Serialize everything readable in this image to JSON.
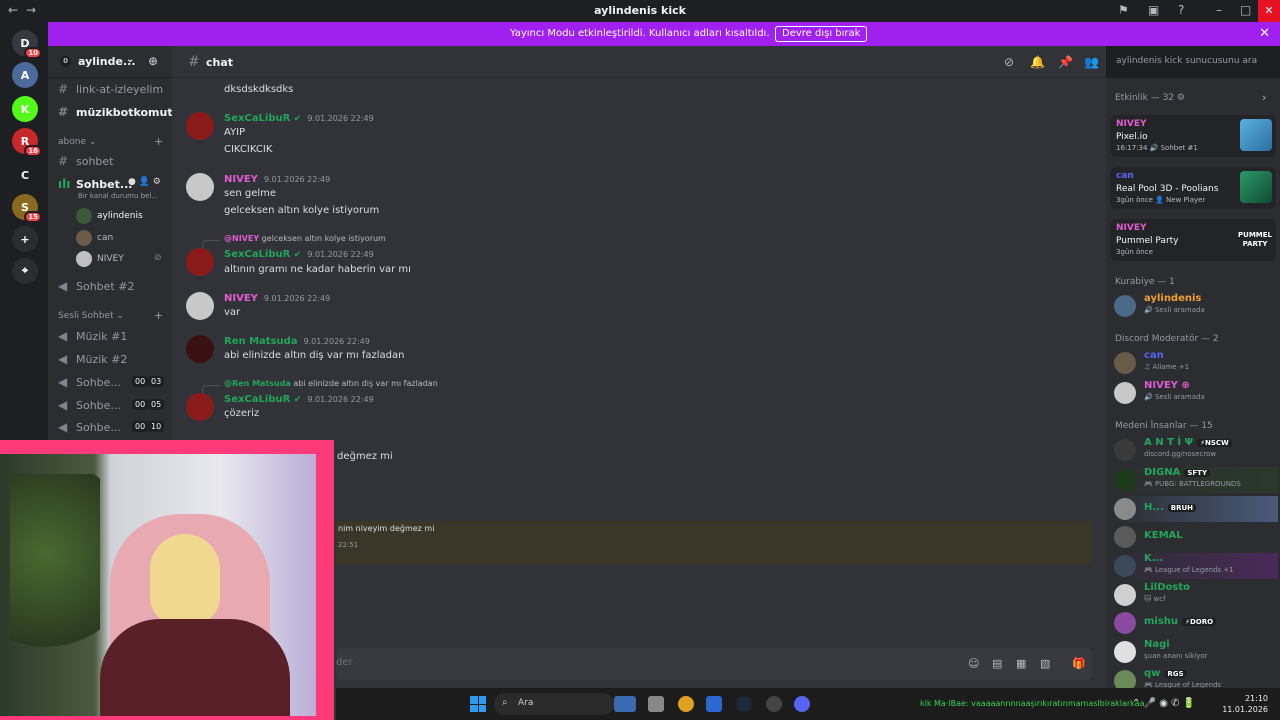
{
  "window": {
    "title": "aylindenis kick"
  },
  "banner": {
    "text": "Yayıncı Modu etkinleştirildi. Kullanıcı adları kısaltıldı.",
    "button": "Devre dışı bırak"
  },
  "servers": [
    {
      "name": "D",
      "badge": "10",
      "color": "#36393f"
    },
    {
      "name": "A",
      "badge": "",
      "color": "#4c6a9c"
    },
    {
      "name": "K",
      "badge": "",
      "color": "#53fc18"
    },
    {
      "name": "R",
      "badge": "16",
      "color": "#c9282b"
    },
    {
      "name": "C",
      "badge": "",
      "color": "#1e1f22"
    },
    {
      "name": "S",
      "badge": "15",
      "color": "#8a6a20"
    },
    {
      "name": "+",
      "badge": "",
      "color": "#2b2d31"
    },
    {
      "name": "⌖",
      "badge": "",
      "color": "#2b2d31"
    }
  ],
  "sidebar": {
    "zero": "0",
    "server_name": "aylinde...",
    "channels_top": [
      {
        "prefix": "#",
        "label": "link-at-izleyelim"
      },
      {
        "prefix": "#",
        "label": "müzikbotkomut"
      }
    ],
    "cat_abone": "abone ⌄",
    "sohbet_text": "sohbet",
    "voice_active": "Sohbet...",
    "voice_status": "Bir kanal durumu bel...",
    "voice_users": [
      "aylindenis",
      "can",
      "NIVEY"
    ],
    "sohbet2": "Sohbet #2",
    "cat_sesli": "Sesli Sohbet ⌄",
    "voice_channels": [
      {
        "label": "Müzik #1",
        "a": "",
        "b": ""
      },
      {
        "label": "Müzik #2",
        "a": "",
        "b": ""
      },
      {
        "label": "Sohbe...",
        "a": "00",
        "b": "03"
      },
      {
        "label": "Sohbe...",
        "a": "00",
        "b": "05"
      },
      {
        "label": "Sohbe...",
        "a": "00",
        "b": "10"
      }
    ]
  },
  "chat": {
    "channel": "chat",
    "search_placeholder": "aylindenis kick sunucusunu ara",
    "composer_placeholder": "der",
    "messages": [
      {
        "line1": "dksdskdksdks"
      },
      {
        "author": "SexCaLibuR",
        "time": "9.01.2026 22:49",
        "line1": "AYIP",
        "line2": "CIKCIKCIK"
      },
      {
        "author": "NIVEY",
        "time": "9.01.2026 22:49",
        "line1": "sen gelme",
        "line2": "gelceksen altın kolye istiyorum"
      },
      {
        "reply_who": "@NIVEY",
        "reply_text": "gelceksen altın kolye istiyorum",
        "author": "SexCaLibuR",
        "time": "9.01.2026 22:49",
        "line1": "altının gramı ne kadar haberin var mı"
      },
      {
        "author": "NIVEY",
        "time": "9.01.2026 22:49",
        "line1": "var"
      },
      {
        "author": "Ren Matsuda",
        "time": "9.01.2026 22:49",
        "line1": "abi elinizde altın diş var mı fazladan"
      },
      {
        "reply_who": "@Ren Matsuda",
        "reply_text": "abi elinizde altın diş var mı fazladan",
        "author": "SexCaLibuR",
        "time": "9.01.2026 22:49",
        "line1": "çözeriz"
      },
      {
        "line1": "değmez mi"
      },
      {
        "line1": "nim niveyim değmez mi",
        "time": "22:51"
      }
    ]
  },
  "members": {
    "activity_title": "Etkinlik — 32 ⚙",
    "activities": [
      {
        "user": "NIVEY",
        "game": "Pixel.io",
        "meta": "16:17:34  🔊 Sohbet #1",
        "color": "#e15bd0"
      },
      {
        "user": "can",
        "game": "Real Pool 3D - Poolians",
        "meta": "3gün önce  👤 New Player",
        "color": "#5865f2"
      },
      {
        "user": "NIVEY",
        "game": "Pummel Party",
        "meta": "3gün önce",
        "color": "#e15bd0"
      }
    ],
    "pummel_logo": "PUMMEL PARTY",
    "sections": [
      {
        "title": "Kurabiye — 1",
        "members": [
          {
            "name": "aylindenis",
            "status": "🔊 Sesli aramada",
            "color": "#f0a030",
            "tag": ""
          }
        ]
      },
      {
        "title": "Discord Moderatör — 2",
        "members": [
          {
            "name": "can",
            "status": "♫ Allame +1",
            "color": "#5865f2",
            "tag": ""
          },
          {
            "name": "NIVEY ⊕",
            "status": "🔊 Sesli aramada",
            "color": "#e15bd0",
            "tag": ""
          }
        ]
      },
      {
        "title": "Medeni İnsanlar — 15",
        "members": [
          {
            "name": "A N T İ Ψ",
            "status": "discord.gg/nosecrow",
            "color": "#23a55a",
            "tag": "⚡NSCW"
          },
          {
            "name": "DIGNA",
            "status": "🎮 PUBG: BATTLEGROUNDS",
            "color": "#23a55a",
            "tag": "SFTY"
          },
          {
            "name": "H...",
            "status": "",
            "color": "#23a55a",
            "tag": "BRUH"
          },
          {
            "name": "KEMAL",
            "status": "",
            "color": "#23a55a",
            "tag": ""
          },
          {
            "name": "K...",
            "status": "🎮 League of Legends +1",
            "color": "#23a55a",
            "tag": ""
          },
          {
            "name": "LilDosto",
            "status": "🐱 wcf",
            "color": "#23a55a",
            "tag": ""
          },
          {
            "name": "mishu",
            "status": "",
            "color": "#23a55a",
            "tag": "⚡DORO"
          },
          {
            "name": "Nagi",
            "status": "şuan ananı sikiyor",
            "color": "#23a55a",
            "tag": ""
          },
          {
            "name": "qw",
            "status": "🎮 League of Legends",
            "color": "#23a55a",
            "tag": "RGS"
          }
        ]
      }
    ]
  },
  "taskbar": {
    "search": "Ara",
    "ticker": "kik Ma·lBae: vaaaaannnnaaşırıkıratınmamaslbiraklarkaa",
    "time": "21:10",
    "date": "11.01.2026"
  }
}
